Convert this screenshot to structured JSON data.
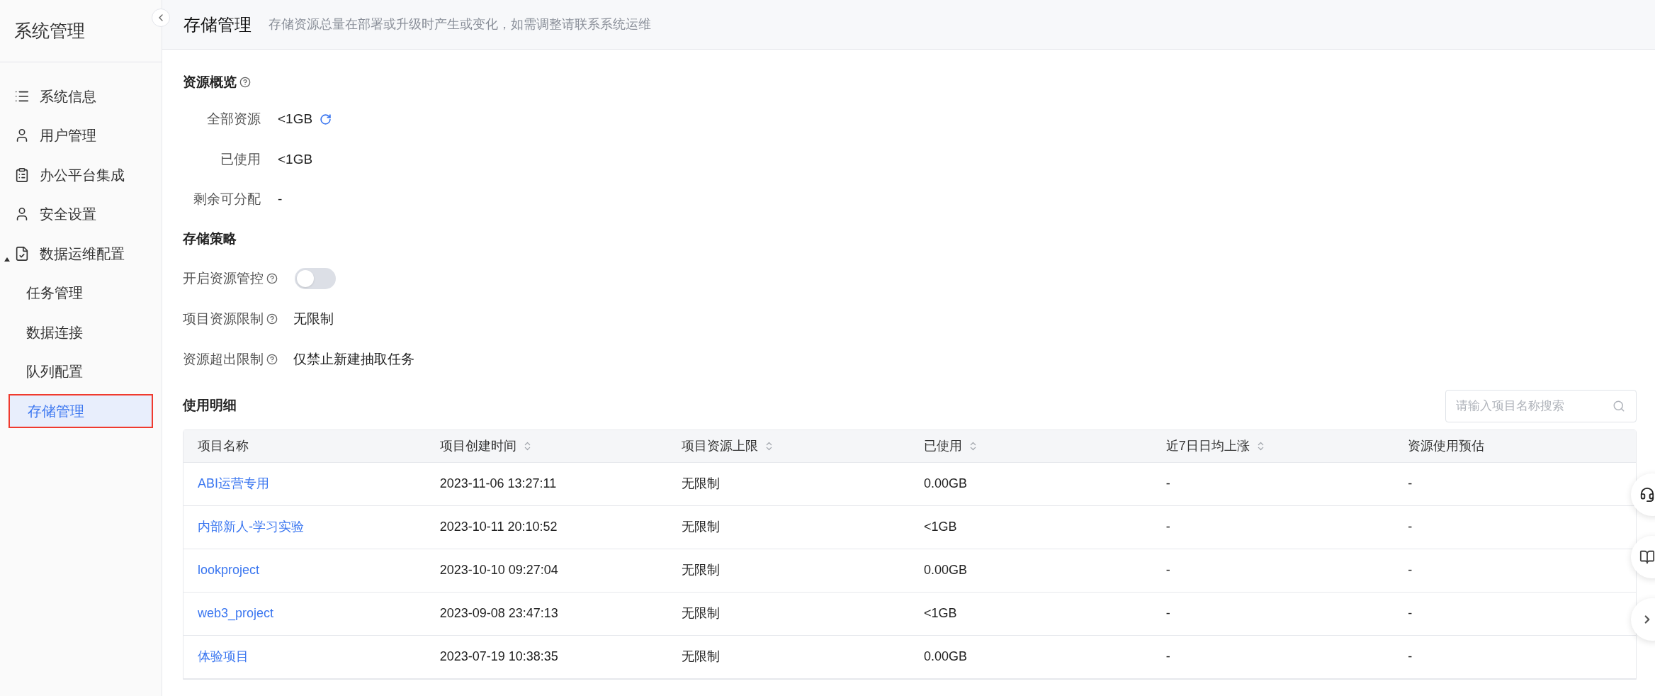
{
  "sidebar": {
    "title": "系统管理",
    "items": [
      {
        "label": "系统信息",
        "selected": false
      },
      {
        "label": "用户管理",
        "selected": false
      },
      {
        "label": "办公平台集成",
        "selected": false
      },
      {
        "label": "安全设置",
        "selected": false
      },
      {
        "label": "数据运维配置",
        "selected": false,
        "expanded": true,
        "children": [
          {
            "label": "任务管理",
            "selected": false
          },
          {
            "label": "数据连接",
            "selected": false
          },
          {
            "label": "队列配置",
            "selected": false
          },
          {
            "label": "存储管理",
            "selected": true
          }
        ]
      }
    ]
  },
  "header": {
    "title": "存储管理",
    "subtitle": "存储资源总量在部署或升级时产生或变化，如需调整请联系系统运维"
  },
  "overview": {
    "title": "资源概览",
    "rows": [
      {
        "label": "全部资源",
        "value": "<1GB",
        "kind": "refreshable"
      },
      {
        "label": "已使用",
        "value": "<1GB",
        "kind": "plain"
      },
      {
        "label": "剩余可分配",
        "value": "-",
        "kind": "plain"
      }
    ]
  },
  "policy": {
    "title": "存储策略",
    "rows": [
      {
        "label": "开启资源管控",
        "kind": "toggle",
        "on": false
      },
      {
        "label": "项目资源限制",
        "kind": "text",
        "value": "无限制"
      },
      {
        "label": "资源超出限制",
        "kind": "text",
        "value": "仅禁止新建抽取任务"
      }
    ]
  },
  "usage": {
    "title": "使用明细",
    "search": {
      "placeholder": "请输入项目名称搜索"
    },
    "table": {
      "columns": [
        {
          "label": "项目名称",
          "sortable": false
        },
        {
          "label": "项目创建时间",
          "sortable": true
        },
        {
          "label": "项目资源上限",
          "sortable": true
        },
        {
          "label": "已使用",
          "sortable": true
        },
        {
          "label": "近7日日均上涨",
          "sortable": true
        },
        {
          "label": "资源使用预估",
          "sortable": false
        }
      ],
      "rows": [
        [
          "ABI运营专用",
          "2023-11-06 13:27:11",
          "无限制",
          "0.00GB",
          "-",
          "-"
        ],
        [
          "内部新人-学习实验",
          "2023-10-11 20:10:52",
          "无限制",
          "<1GB",
          "-",
          "-"
        ],
        [
          "lookproject",
          "2023-10-10 09:27:04",
          "无限制",
          "0.00GB",
          "-",
          "-"
        ],
        [
          "web3_project",
          "2023-09-08 23:47:13",
          "无限制",
          "<1GB",
          "-",
          "-"
        ],
        [
          "体验项目",
          "2023-07-19 10:38:35",
          "无限制",
          "0.00GB",
          "-",
          "-"
        ]
      ]
    }
  }
}
